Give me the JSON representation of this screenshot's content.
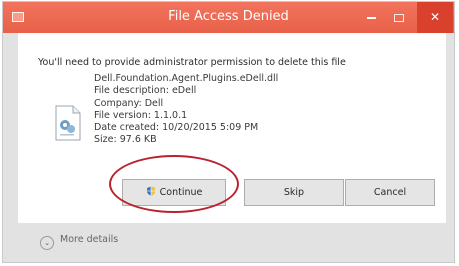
{
  "window": {
    "title": "File Access Denied",
    "close_glyph": "✕"
  },
  "message": "You'll need to provide administrator permission to delete this file",
  "file": {
    "name": "Dell.Foundation.Agent.Plugins.eDell.dll",
    "description": "File description: eDell",
    "company": "Company: Dell",
    "version": "File version: 1.1.0.1",
    "created": "Date created: 10/20/2015 5:09 PM",
    "size": "Size: 97.6 KB"
  },
  "buttons": {
    "continue": "Continue",
    "skip": "Skip",
    "cancel": "Cancel"
  },
  "more_details": "More details",
  "icons": {
    "app": "window-icon",
    "file": "file-icon",
    "shield": "uac-shield-icon",
    "chevron": "chevron-down-icon"
  },
  "colors": {
    "titlebar": "#ec6751",
    "close_button": "#d9412d",
    "highlight_ring": "#b8232f"
  }
}
